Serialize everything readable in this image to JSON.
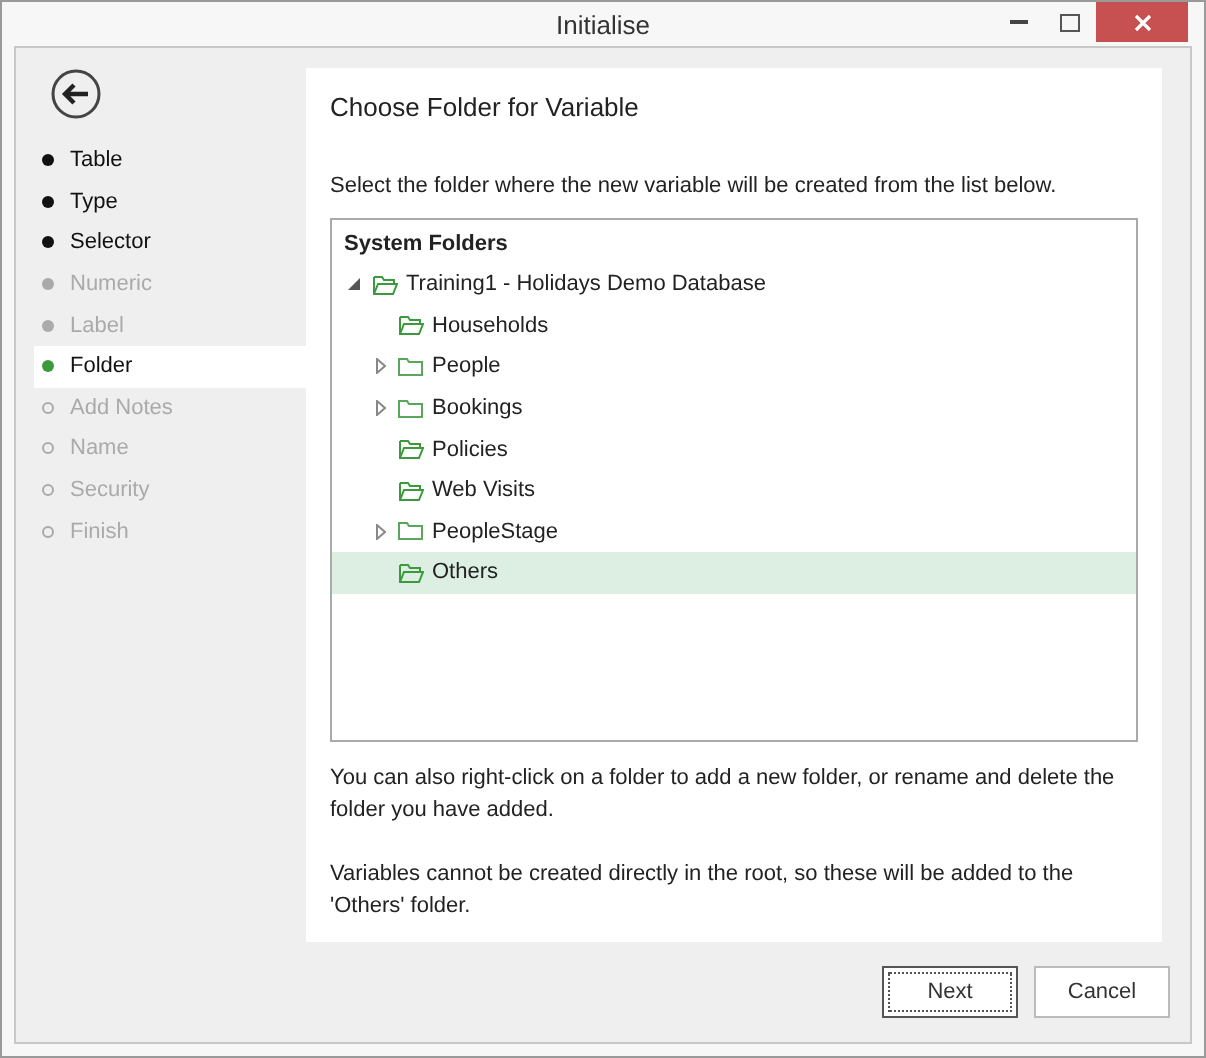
{
  "window": {
    "title": "Initialise"
  },
  "steps": [
    {
      "label": "Table",
      "kind": "done",
      "selected": false
    },
    {
      "label": "Type",
      "kind": "done",
      "selected": false
    },
    {
      "label": "Selector",
      "kind": "done",
      "selected": false
    },
    {
      "label": "Numeric",
      "kind": "skipped",
      "selected": false
    },
    {
      "label": "Label",
      "kind": "skipped",
      "selected": false
    },
    {
      "label": "Folder",
      "kind": "current",
      "selected": true
    },
    {
      "label": "Add Notes",
      "kind": "pending",
      "selected": false
    },
    {
      "label": "Name",
      "kind": "pending",
      "selected": false
    },
    {
      "label": "Security",
      "kind": "pending",
      "selected": false
    },
    {
      "label": "Finish",
      "kind": "pending",
      "selected": false
    }
  ],
  "heading": "Choose Folder for Variable",
  "instruction": "Select the folder where the new variable will be created from the list below.",
  "tree": {
    "header": "System Folders",
    "items": [
      {
        "label": "Training1 - Holidays Demo Database",
        "expanded": true,
        "selected": false,
        "children": [
          {
            "label": "Households",
            "selected": false
          },
          {
            "label": "People",
            "expanded": false,
            "selected": false
          },
          {
            "label": "Bookings",
            "expanded": false,
            "selected": false
          },
          {
            "label": "Policies",
            "selected": false
          },
          {
            "label": "Web Visits",
            "selected": false
          },
          {
            "label": "PeopleStage",
            "expanded": false,
            "selected": false
          },
          {
            "label": "Others",
            "selected": true
          }
        ]
      }
    ]
  },
  "notes": [
    "You can also right-click on a folder to add a new folder, or rename and delete the folder you have added.",
    "Variables cannot be created directly in the root, so these will be added to the 'Others' folder."
  ],
  "buttons": [
    {
      "label": "Next",
      "focused": true
    },
    {
      "label": "Cancel",
      "focused": false
    }
  ]
}
